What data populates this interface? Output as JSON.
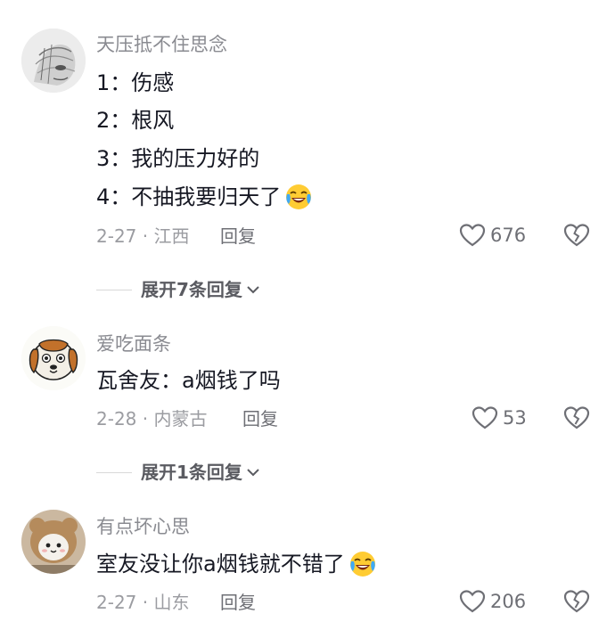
{
  "comments": [
    {
      "username": "天压抵不住思念",
      "lines": [
        "1：伤感",
        "2：根风",
        "3：我的压力好的",
        "4：不抽我要归天了"
      ],
      "date_location": "2-27 · 江西",
      "reply_label": "回复",
      "likes": "676",
      "expand_label": "展开7条回复",
      "avatar_icon": "sketch-portrait-avatar",
      "trailing_emoji": "laugh-cry-emoji"
    },
    {
      "username": "爱吃面条",
      "lines": [
        "瓦舍友：a烟钱了吗"
      ],
      "date_location": "2-28 · 内蒙古",
      "reply_label": "回复",
      "likes": "53",
      "expand_label": "展开1条回复",
      "avatar_icon": "beagle-dog-avatar"
    },
    {
      "username": "有点坏心思",
      "lines": [
        "室友没让你a烟钱就不错了"
      ],
      "date_location": "2-27 · 山东",
      "reply_label": "回复",
      "likes": "206",
      "avatar_icon": "cat-costume-avatar",
      "trailing_emoji": "laugh-cry-emoji"
    }
  ],
  "colors": {
    "text_primary": "#161823",
    "text_secondary": "#8a8b91",
    "icon_gray": "#6e6f75"
  }
}
